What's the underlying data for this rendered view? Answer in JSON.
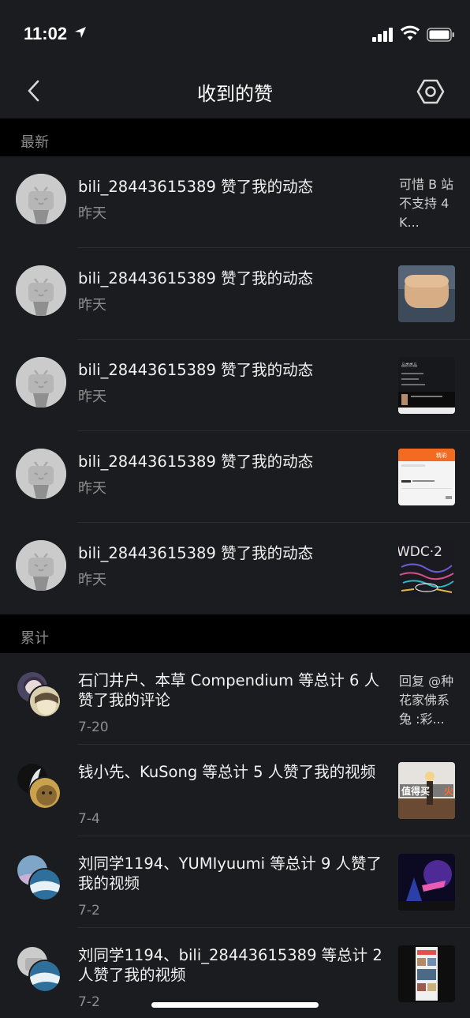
{
  "status": {
    "time": "11:02"
  },
  "nav": {
    "title": "收到的赞"
  },
  "sections": {
    "latest": "最新",
    "total": "累计"
  },
  "latest": [
    {
      "user": "bili_28443615389",
      "action": "赞了我的动态",
      "date": "昨天",
      "preview_text": "可惜 B 站不支持 4K..."
    },
    {
      "user": "bili_28443615389",
      "action": "赞了我的动态",
      "date": "昨天",
      "thumb": "airpods-case"
    },
    {
      "user": "bili_28443615389",
      "action": "赞了我的动态",
      "date": "昨天",
      "thumb": "dark-screenshot"
    },
    {
      "user": "bili_28443615389",
      "action": "赞了我的动态",
      "date": "昨天",
      "thumb": "orange-app-screenshot"
    },
    {
      "user": "bili_28443615389",
      "action": "赞了我的动态",
      "date": "昨天",
      "thumb": "wwdc-art"
    }
  ],
  "total": [
    {
      "text": "石门井户、本草 Compendium 等总计 6 人赞了我的评论",
      "date": "7-20",
      "preview_text": "回复 @种花家佛系兔 :彩..."
    },
    {
      "text": "钱小先、KuSong 等总计 5 人赞了我的视频",
      "date": "7-4",
      "thumb": "video-thumb-1"
    },
    {
      "text": "刘同学1194、YUMIyuumi 等总计 9 人赞了我的视频",
      "date": "7-2",
      "thumb": "video-thumb-2"
    },
    {
      "text": "刘同学1194、bili_28443615389 等总计 2 人赞了我的视频",
      "date": "7-2",
      "thumb": "video-thumb-3"
    }
  ],
  "thumb_text": {
    "t3_title": "品质质品",
    "t4_brand": "精彩",
    "t5": "WDC·2",
    "t6": "值得买",
    "t6b": "火"
  }
}
